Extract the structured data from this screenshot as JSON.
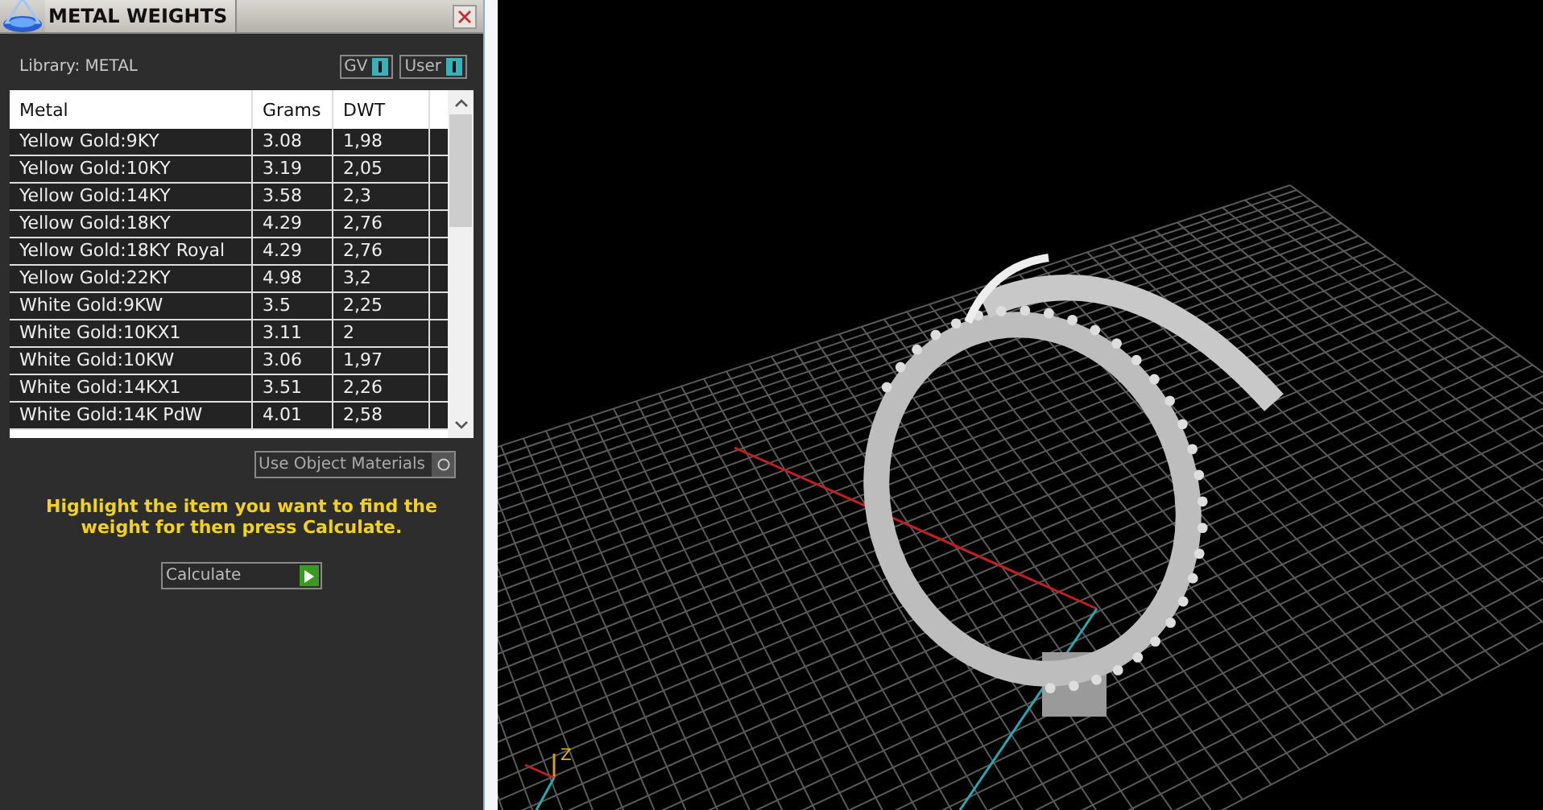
{
  "panel": {
    "title": "METAL WEIGHTS",
    "library": "Library: METAL",
    "toggles": [
      {
        "label": "GV",
        "on": true
      },
      {
        "label": "User",
        "on": true
      }
    ],
    "table": {
      "columns": [
        "Metal",
        "Grams",
        "DWT"
      ],
      "rows": [
        [
          "Yellow Gold:9KY",
          "3.08",
          "1,98"
        ],
        [
          "Yellow Gold:10KY",
          "3.19",
          "2,05"
        ],
        [
          "Yellow Gold:14KY",
          "3.58",
          "2,3"
        ],
        [
          "Yellow Gold:18KY",
          "4.29",
          "2,76"
        ],
        [
          "Yellow Gold:18KY Royal",
          "4.29",
          "2,76"
        ],
        [
          "Yellow Gold:22KY",
          "4.98",
          "3,2"
        ],
        [
          "White Gold:9KW",
          "3.5",
          "2,25"
        ],
        [
          "White Gold:10KX1",
          "3.11",
          "2"
        ],
        [
          "White Gold:10KW",
          "3.06",
          "1,97"
        ],
        [
          "White Gold:14KX1",
          "3.51",
          "2,26"
        ],
        [
          "White Gold:14K PdW",
          "4.01",
          "2,58"
        ]
      ]
    },
    "use_object_materials": {
      "label": "Use Object Materials",
      "on": false
    },
    "instruction": "Highlight the item you want to find the weight for then press Calculate.",
    "calculate_button": "Calculate"
  },
  "viewport": {
    "axis_label": "Z"
  }
}
